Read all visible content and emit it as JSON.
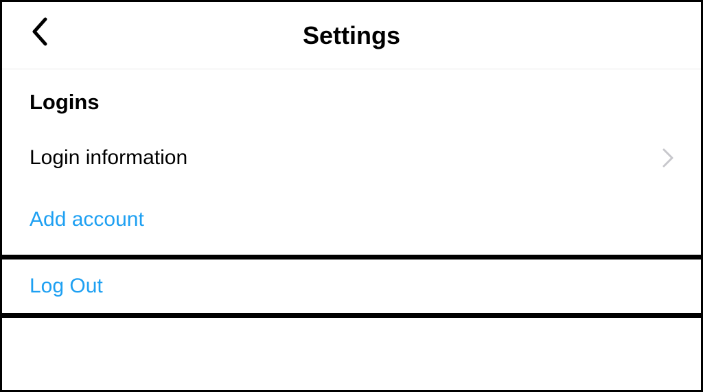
{
  "header": {
    "title": "Settings"
  },
  "section": {
    "heading": "Logins"
  },
  "rows": {
    "loginInformation": "Login information",
    "addAccount": "Add account",
    "logOut": "Log Out"
  },
  "colors": {
    "link": "#1ea0f2",
    "text": "#000000",
    "chevron": "#c7c7cc"
  }
}
